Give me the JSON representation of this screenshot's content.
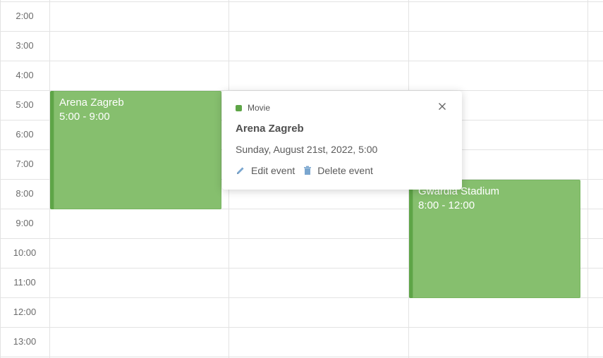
{
  "time_labels": [
    "2:00",
    "3:00",
    "4:00",
    "5:00",
    "6:00",
    "7:00",
    "8:00",
    "9:00",
    "10:00",
    "11:00",
    "12:00",
    "13:00"
  ],
  "events": [
    {
      "title": "Arena Zagreb",
      "time": "5:00 - 9:00"
    },
    {
      "title": "Gwardia Stadium",
      "time": "8:00 - 12:00"
    }
  ],
  "popup": {
    "category": "Movie",
    "title": "Arena Zagreb",
    "date": "Sunday, August 21st, 2022, 5:00",
    "edit_label": "Edit event",
    "delete_label": "Delete event"
  },
  "colors": {
    "event_fill": "#86bf6e",
    "event_border": "#5ea547",
    "category_dot": "#5ea547",
    "grid_line": "#e3e3e3"
  },
  "icons": {
    "close": "close-icon",
    "edit": "pencil-icon",
    "delete": "trash-icon"
  }
}
